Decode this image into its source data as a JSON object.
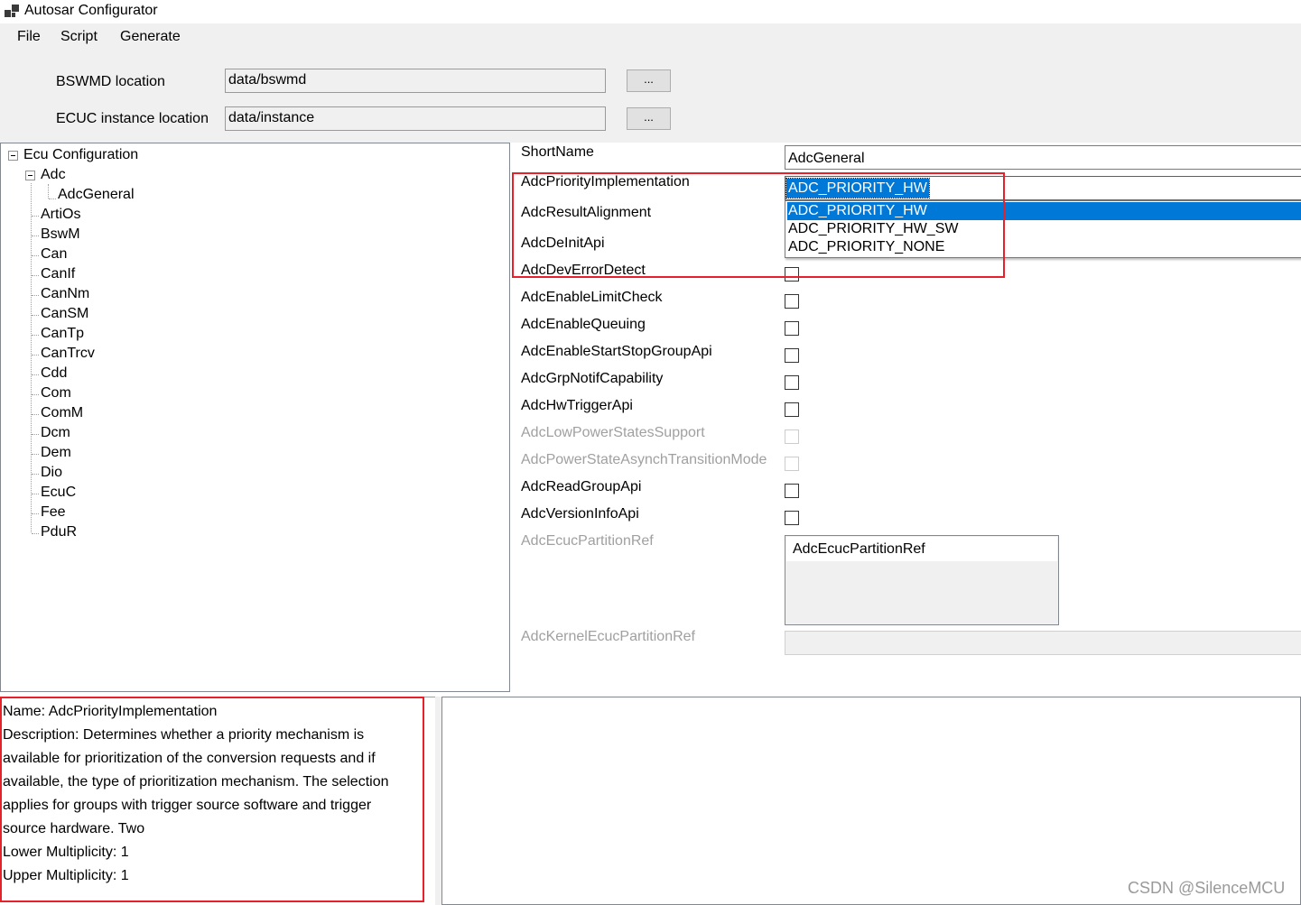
{
  "window": {
    "title": "Autosar Configurator",
    "icon": "app-window-icon"
  },
  "menu": {
    "items": [
      "File",
      "Script",
      "Generate"
    ]
  },
  "locations": {
    "bswmd": {
      "label": "BSWMD location",
      "value": "data/bswmd",
      "button": "..."
    },
    "ecuc": {
      "label": "ECUC instance location",
      "value": "data/instance",
      "button": "..."
    }
  },
  "tree": {
    "root": "Ecu Configuration",
    "adc": "Adc",
    "adc_child": "AdcGeneral",
    "modules": [
      "ArtiOs",
      "BswM",
      "Can",
      "CanIf",
      "CanNm",
      "CanSM",
      "CanTp",
      "CanTrcv",
      "Cdd",
      "Com",
      "ComM",
      "Dcm",
      "Dem",
      "Dio",
      "EcuC",
      "Fee",
      "PduR"
    ]
  },
  "properties": {
    "shortname": {
      "label": "ShortName",
      "value": "AdcGeneral"
    },
    "priority": {
      "label": "AdcPriorityImplementation",
      "value": "ADC_PRIORITY_HW",
      "options": [
        "ADC_PRIORITY_HW",
        "ADC_PRIORITY_HW_SW",
        "ADC_PRIORITY_NONE"
      ],
      "highlighted_option": 0
    },
    "labels": {
      "result_alignment": "AdcResultAlignment",
      "deinit_api": "AdcDeInitApi"
    },
    "checkbox_rows": [
      {
        "label": "AdcDevErrorDetect",
        "checked": false,
        "enabled": true
      },
      {
        "label": "AdcEnableLimitCheck",
        "checked": false,
        "enabled": true
      },
      {
        "label": "AdcEnableQueuing",
        "checked": false,
        "enabled": true
      },
      {
        "label": "AdcEnableStartStopGroupApi",
        "checked": false,
        "enabled": true
      },
      {
        "label": "AdcGrpNotifCapability",
        "checked": false,
        "enabled": true
      },
      {
        "label": "AdcHwTriggerApi",
        "checked": false,
        "enabled": true
      },
      {
        "label": "AdcLowPowerStatesSupport",
        "checked": false,
        "enabled": false
      },
      {
        "label": "AdcPowerStateAsynchTransitionMode",
        "checked": false,
        "enabled": false
      },
      {
        "label": "AdcReadGroupApi",
        "checked": false,
        "enabled": true
      },
      {
        "label": "AdcVersionInfoApi",
        "checked": false,
        "enabled": true
      }
    ],
    "ecuc_partition_ref": {
      "label": "AdcEcucPartitionRef",
      "items": [
        "AdcEcucPartitionRef"
      ]
    },
    "kernel_ref": {
      "label": "AdcKernelEcucPartitionRef"
    }
  },
  "description": {
    "lines": [
      "Name: AdcPriorityImplementation",
      "Description: Determines whether a priority mechanism is",
      "available for prioritization of the conversion requests and if",
      "available, the type of prioritization mechanism. The selection",
      "applies for groups with trigger source software and trigger",
      "source hardware. Two",
      "Lower Multiplicity: 1",
      "Upper Multiplicity: 1"
    ]
  },
  "watermark": "CSDN @SilenceMCU",
  "colors": {
    "selection": "#0078d7",
    "annotation": "#e8202a",
    "panel": "#f0f0f0"
  }
}
